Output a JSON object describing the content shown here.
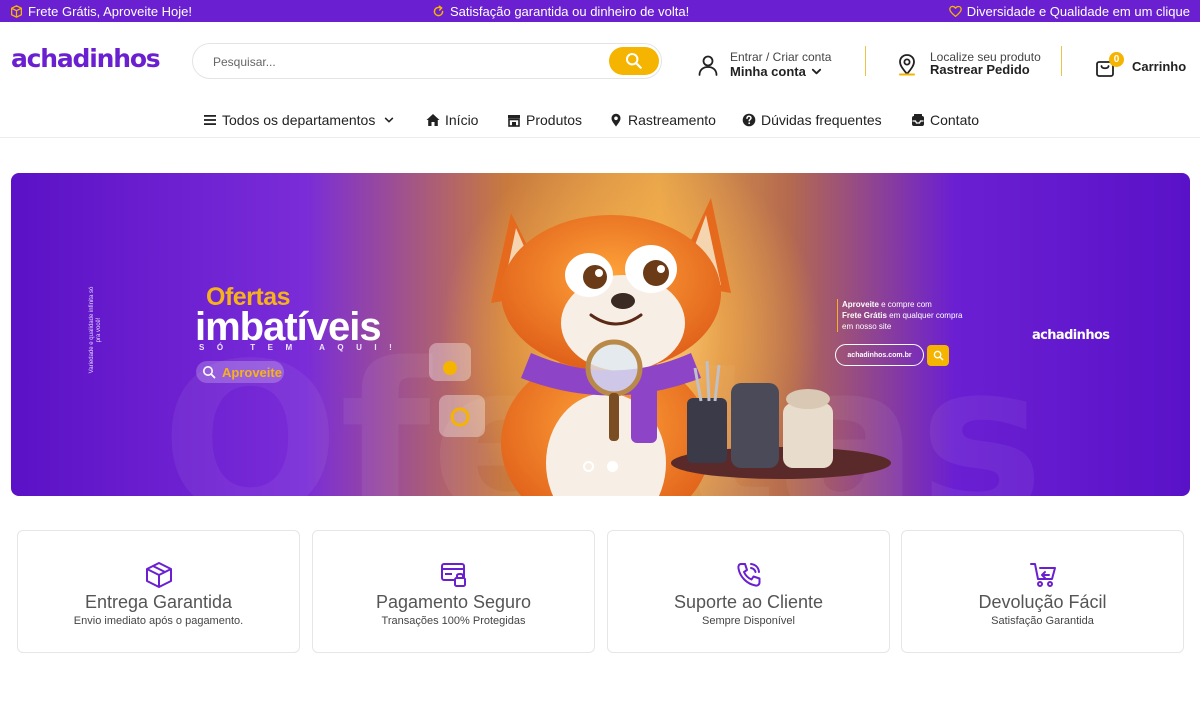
{
  "colors": {
    "brand": "#6a1fd0",
    "accent": "#f4b400"
  },
  "topbar": {
    "left": "Frete Grátis, Aproveite Hoje!",
    "center": "Satisfação garantida ou dinheiro de volta!",
    "right": "Diversidade e Qualidade em um clique",
    "icons": [
      "package-icon",
      "refresh-icon",
      "heart-icon"
    ]
  },
  "header": {
    "logo": "achadinhos",
    "search": {
      "placeholder": "Pesquisar..."
    },
    "account": {
      "line1": "Entrar / Criar conta",
      "line2": "Minha conta"
    },
    "track": {
      "line1": "Localize seu produto",
      "line2": "Rastrear Pedido"
    },
    "cart": {
      "badge": "0",
      "label": "Carrinho"
    }
  },
  "nav": {
    "items": [
      {
        "label": "Todos os departamentos",
        "icon": "menu-icon"
      },
      {
        "label": "Início",
        "icon": "home-icon"
      },
      {
        "label": "Produtos",
        "icon": "store-icon"
      },
      {
        "label": "Rastreamento",
        "icon": "location-pin-icon"
      },
      {
        "label": "Dúvidas frequentes",
        "icon": "question-icon"
      },
      {
        "label": "Contato",
        "icon": "inbox-icon"
      }
    ]
  },
  "banner": {
    "side_text": "Variedade e qualidade infinita só pra você!",
    "headline_1": "Ofertas",
    "headline_2": "imbatíveis",
    "headline_3": "SÓ TEM AQUI!",
    "pill": "Aproveite",
    "promo_bold_1": "Aproveite",
    "promo_1": " e compre com",
    "promo_bold_2": "Frete Grátis",
    "promo_2": " em qualquer compra em nosso site",
    "url": "achadinhos.com.br",
    "logo": "achadinhos",
    "slide_count": 2,
    "active_slide": 2
  },
  "features": [
    {
      "title": "Entrega Garantida",
      "subtitle": "Envio imediato após o pagamento.",
      "icon": "box-icon"
    },
    {
      "title": "Pagamento Seguro",
      "subtitle": "Transações 100% Protegidas",
      "icon": "secure-payment-icon"
    },
    {
      "title": "Suporte ao Cliente",
      "subtitle": "Sempre Disponível",
      "icon": "phone-support-icon"
    },
    {
      "title": "Devolução Fácil",
      "subtitle": "Satisfação Garantida",
      "icon": "cart-return-icon"
    }
  ]
}
